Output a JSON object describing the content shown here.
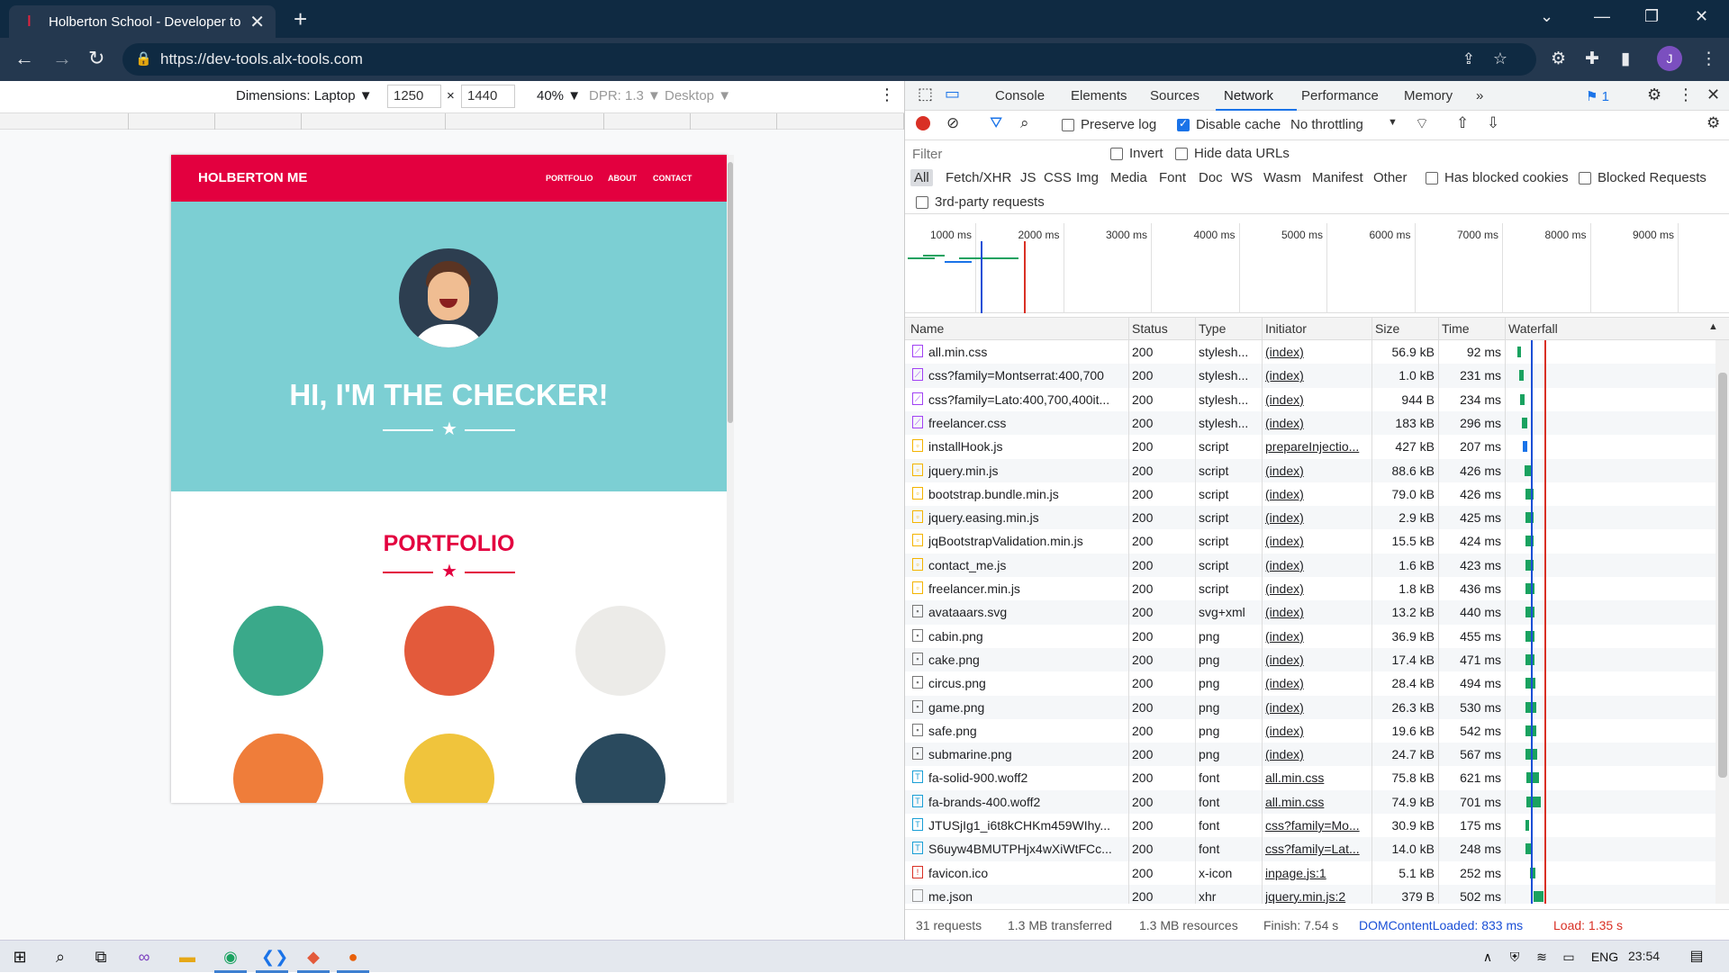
{
  "browser": {
    "tab_title": "Holberton School - Developer to",
    "url": "https://dev-tools.alx-tools.com",
    "profile_initial": "J"
  },
  "device_toolbar": {
    "dimensions": "Dimensions: Laptop ▼",
    "width": "1250",
    "height": "1440",
    "times": "×",
    "zoom": "40% ▼",
    "dpr": "DPR: 1.3 ▼",
    "mode": "Desktop ▼"
  },
  "site": {
    "brand": "HOLBERTON ME",
    "nav": [
      "PORTFOLIO",
      "ABOUT",
      "CONTACT"
    ],
    "hero_title": "HI, I'M THE CHECKER!",
    "section_title": "PORTFOLIO",
    "tile_colors": [
      "#c24f64",
      "#1fa3b8",
      "#161212",
      "#2a7fc9",
      "#1f3fba",
      "#d2b4a6"
    ]
  },
  "devtools": {
    "tabs": [
      "Console",
      "Elements",
      "Sources",
      "Network",
      "Performance",
      "Memory"
    ],
    "more_tabs": "»",
    "issues_count": "1",
    "toolbar": {
      "preserve_log": "Preserve log",
      "disable_cache": "Disable cache",
      "throttling": "No throttling"
    },
    "filter_placeholder": "Filter",
    "invert": "Invert",
    "hide_data_urls": "Hide data URLs",
    "type_filters": [
      "All",
      "Fetch/XHR",
      "JS",
      "CSS",
      "Img",
      "Media",
      "Font",
      "Doc",
      "WS",
      "Wasm",
      "Manifest",
      "Other"
    ],
    "has_blocked_cookies": "Has blocked cookies",
    "blocked_requests": "Blocked Requests",
    "third_party": "3rd-party requests",
    "timeline_ticks": [
      "1000 ms",
      "2000 ms",
      "3000 ms",
      "4000 ms",
      "5000 ms",
      "6000 ms",
      "7000 ms",
      "8000 ms",
      "9000 ms"
    ],
    "columns": [
      "Name",
      "Status",
      "Type",
      "Initiator",
      "Size",
      "Time",
      "Waterfall"
    ],
    "requests": [
      {
        "name": "all.min.css",
        "status": "200",
        "type": "stylesh...",
        "initiator": "(index)",
        "size": "56.9 kB",
        "time": "92 ms",
        "kind": "css"
      },
      {
        "name": "css?family=Montserrat:400,700",
        "status": "200",
        "type": "stylesh...",
        "initiator": "(index)",
        "size": "1.0 kB",
        "time": "231 ms",
        "kind": "css"
      },
      {
        "name": "css?family=Lato:400,700,400it...",
        "status": "200",
        "type": "stylesh...",
        "initiator": "(index)",
        "size": "944 B",
        "time": "234 ms",
        "kind": "css"
      },
      {
        "name": "freelancer.css",
        "status": "200",
        "type": "stylesh...",
        "initiator": "(index)",
        "size": "183 kB",
        "time": "296 ms",
        "kind": "css"
      },
      {
        "name": "installHook.js",
        "status": "200",
        "type": "script",
        "initiator": "prepareInjectio...",
        "size": "427 kB",
        "time": "207 ms",
        "kind": "js"
      },
      {
        "name": "jquery.min.js",
        "status": "200",
        "type": "script",
        "initiator": "(index)",
        "size": "88.6 kB",
        "time": "426 ms",
        "kind": "js"
      },
      {
        "name": "bootstrap.bundle.min.js",
        "status": "200",
        "type": "script",
        "initiator": "(index)",
        "size": "79.0 kB",
        "time": "426 ms",
        "kind": "js"
      },
      {
        "name": "jquery.easing.min.js",
        "status": "200",
        "type": "script",
        "initiator": "(index)",
        "size": "2.9 kB",
        "time": "425 ms",
        "kind": "js"
      },
      {
        "name": "jqBootstrapValidation.min.js",
        "status": "200",
        "type": "script",
        "initiator": "(index)",
        "size": "15.5 kB",
        "time": "424 ms",
        "kind": "js"
      },
      {
        "name": "contact_me.js",
        "status": "200",
        "type": "script",
        "initiator": "(index)",
        "size": "1.6 kB",
        "time": "423 ms",
        "kind": "js"
      },
      {
        "name": "freelancer.min.js",
        "status": "200",
        "type": "script",
        "initiator": "(index)",
        "size": "1.8 kB",
        "time": "436 ms",
        "kind": "js"
      },
      {
        "name": "avataaars.svg",
        "status": "200",
        "type": "svg+xml",
        "initiator": "(index)",
        "size": "13.2 kB",
        "time": "440 ms",
        "kind": "img"
      },
      {
        "name": "cabin.png",
        "status": "200",
        "type": "png",
        "initiator": "(index)",
        "size": "36.9 kB",
        "time": "455 ms",
        "kind": "img"
      },
      {
        "name": "cake.png",
        "status": "200",
        "type": "png",
        "initiator": "(index)",
        "size": "17.4 kB",
        "time": "471 ms",
        "kind": "img"
      },
      {
        "name": "circus.png",
        "status": "200",
        "type": "png",
        "initiator": "(index)",
        "size": "28.4 kB",
        "time": "494 ms",
        "kind": "img"
      },
      {
        "name": "game.png",
        "status": "200",
        "type": "png",
        "initiator": "(index)",
        "size": "26.3 kB",
        "time": "530 ms",
        "kind": "img"
      },
      {
        "name": "safe.png",
        "status": "200",
        "type": "png",
        "initiator": "(index)",
        "size": "19.6 kB",
        "time": "542 ms",
        "kind": "img"
      },
      {
        "name": "submarine.png",
        "status": "200",
        "type": "png",
        "initiator": "(index)",
        "size": "24.7 kB",
        "time": "567 ms",
        "kind": "img"
      },
      {
        "name": "fa-solid-900.woff2",
        "status": "200",
        "type": "font",
        "initiator": "all.min.css",
        "size": "75.8 kB",
        "time": "621 ms",
        "kind": "font"
      },
      {
        "name": "fa-brands-400.woff2",
        "status": "200",
        "type": "font",
        "initiator": "all.min.css",
        "size": "74.9 kB",
        "time": "701 ms",
        "kind": "font"
      },
      {
        "name": "JTUSjIg1_i6t8kCHKm459WIhy...",
        "status": "200",
        "type": "font",
        "initiator": "css?family=Mo...",
        "size": "30.9 kB",
        "time": "175 ms",
        "kind": "font"
      },
      {
        "name": "S6uyw4BMUTPHjx4wXiWtFCc...",
        "status": "200",
        "type": "font",
        "initiator": "css?family=Lat...",
        "size": "14.0 kB",
        "time": "248 ms",
        "kind": "font"
      },
      {
        "name": "favicon.ico",
        "status": "200",
        "type": "x-icon",
        "initiator": "inpage.js:1",
        "size": "5.1 kB",
        "time": "252 ms",
        "kind": "ico"
      },
      {
        "name": "me.json",
        "status": "200",
        "type": "xhr",
        "initiator": "jquery.min.js:2",
        "size": "379 B",
        "time": "502 ms",
        "kind": "xhr"
      }
    ],
    "status": {
      "requests": "31 requests",
      "transferred": "1.3 MB transferred",
      "resources": "1.3 MB resources",
      "finish": "Finish: 7.54 s",
      "dcl": "DOMContentLoaded: 833 ms",
      "load": "Load: 1.35 s",
      "dcl_color": "#1a4fd6",
      "load_color": "#d93025"
    }
  },
  "taskbar": {
    "lang": "ENG",
    "time": "23:54"
  }
}
